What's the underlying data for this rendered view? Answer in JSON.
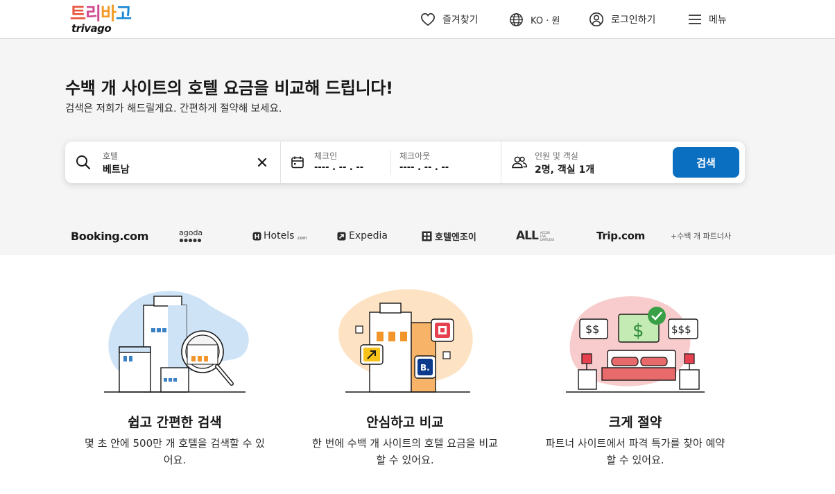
{
  "header": {
    "logo_ko": [
      "트",
      "리",
      "바",
      "고"
    ],
    "logo_en": "trivago",
    "favorites_label": "즐겨찾기",
    "locale_label": "KO · 원",
    "login_label": "로그인하기",
    "menu_label": "메뉴"
  },
  "hero": {
    "title": "수백 개 사이트의 호텔 요금을 비교해 드립니다!",
    "subtitle": "검색은 저희가 해드릴게요. 간편하게 절약해 보세요."
  },
  "search": {
    "destination_label": "호텔",
    "destination_value": "베트남",
    "checkin_label": "체크인",
    "checkin_value": "---- . -- . --",
    "checkout_label": "체크아웃",
    "checkout_value": "---- . -- . --",
    "guests_label": "인원 및 객실",
    "guests_value": "2명, 객실 1개",
    "search_button": "검색"
  },
  "partners": {
    "booking": "Booking.com",
    "agoda": "agoda",
    "hotels": "Hotels",
    "hotels_suffix": ".com",
    "expedia": "Expedia",
    "hoteljoy": "호텔엔조이",
    "all": "ALL",
    "all_tag": [
      "ACCOR",
      "LIVE",
      "LIMITLESS"
    ],
    "trip": "Trip.com",
    "more": "+수백 개 파트너사"
  },
  "features": [
    {
      "title": "쉽고 간편한 검색",
      "desc": "몇 초 안에 500만 개 호텔을 검색할 수 있어요."
    },
    {
      "title": "안심하고 비교",
      "desc": "한 번에 수백 개 사이트의 호텔 요금을 비교할 수 있어요."
    },
    {
      "title": "크게 절약",
      "desc": "파트너 사이트에서 파격 특가를 찾아 예약할 수 있어요."
    }
  ],
  "illustrations": {
    "price_small": "$$",
    "price_mid": "$",
    "price_large": "$$$",
    "booking_badge": "B."
  },
  "colors": {
    "logo_t": "#e8543c",
    "logo_ri": "#d04a8f",
    "logo_ba": "#f29a25",
    "logo_go": "#1a88d4",
    "primary": "#0a6fc0",
    "hero_bg": "#f5f5f6"
  },
  "icons": {
    "favorites": "heart-outline-icon",
    "locale": "globe-icon",
    "login": "user-circle-icon",
    "menu": "hamburger-icon",
    "search": "magnifier-icon",
    "clear": "close-icon",
    "calendar": "calendar-icon",
    "guests": "users-icon"
  }
}
